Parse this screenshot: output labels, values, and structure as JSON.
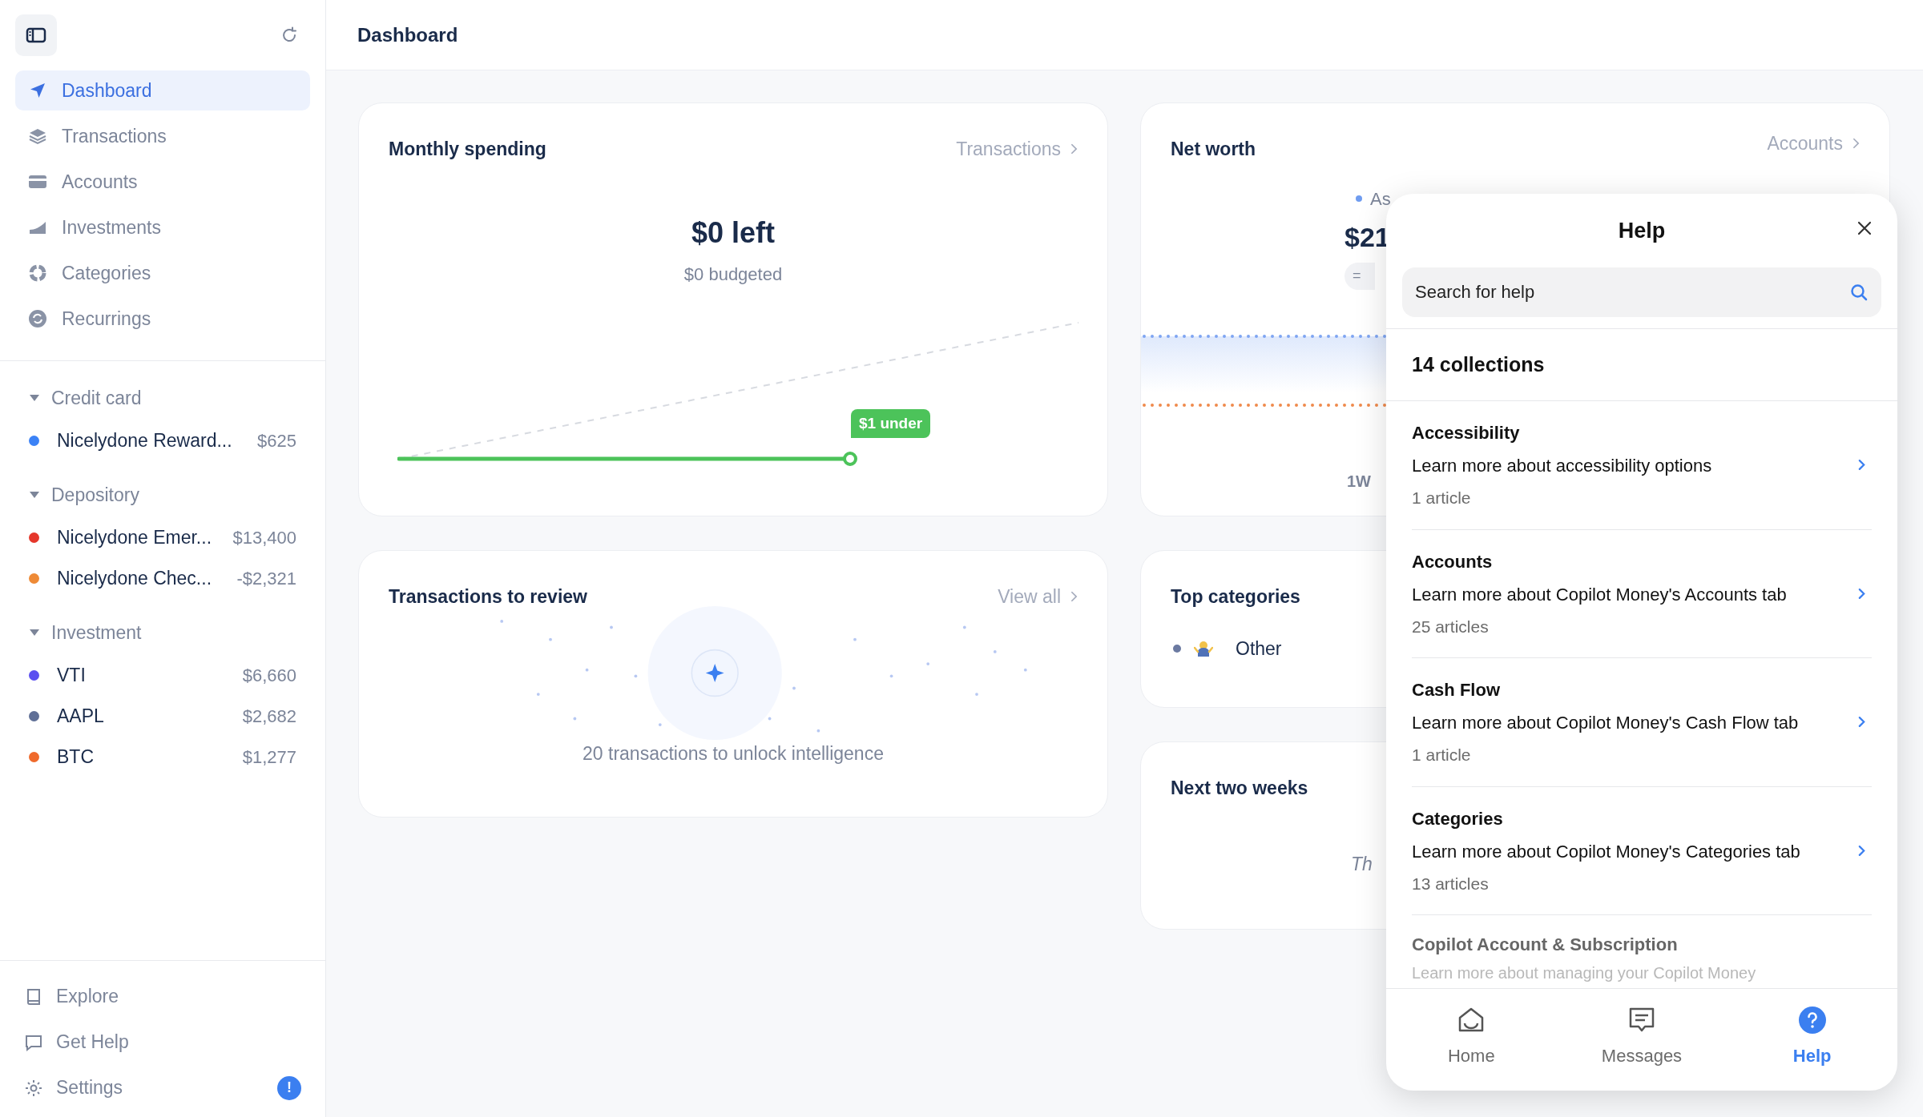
{
  "sidebar": {
    "nav": [
      {
        "label": "Dashboard",
        "selected": true
      },
      {
        "label": "Transactions",
        "selected": false
      },
      {
        "label": "Accounts",
        "selected": false
      },
      {
        "label": "Investments",
        "selected": false
      },
      {
        "label": "Categories",
        "selected": false
      },
      {
        "label": "Recurrings",
        "selected": false
      }
    ],
    "groups": [
      {
        "label": "Credit card",
        "expanded": true,
        "accounts": [
          {
            "name": "Nicelydone Reward...",
            "amount": "$625",
            "color": "#3b82f6"
          }
        ]
      },
      {
        "label": "Depository",
        "expanded": true,
        "accounts": [
          {
            "name": "Nicelydone Emer...",
            "amount": "$13,400",
            "color": "#e5372b"
          },
          {
            "name": "Nicelydone Chec...",
            "amount": "-$2,321",
            "color": "#ee8a36"
          }
        ]
      },
      {
        "label": "Investment",
        "expanded": true,
        "accounts": [
          {
            "name": "VTI",
            "amount": "$6,660",
            "color": "#5b4ff0"
          },
          {
            "name": "AAPL",
            "amount": "$2,682",
            "color": "#5f6f96"
          },
          {
            "name": "BTC",
            "amount": "$1,277",
            "color": "#ef6a2c"
          }
        ]
      }
    ],
    "footer": [
      {
        "label": "Explore"
      },
      {
        "label": "Get Help"
      },
      {
        "label": "Settings",
        "badge": "!"
      }
    ]
  },
  "header": {
    "title": "Dashboard"
  },
  "monthly_spending": {
    "title": "Monthly spending",
    "link": "Transactions",
    "amount": "$0 left",
    "budget": "$0 budgeted",
    "marker": "$1 under"
  },
  "net_worth": {
    "title": "Net worth",
    "link": "Accounts",
    "legend": "As",
    "value": "$21",
    "pill": "=",
    "period": "1W"
  },
  "transactions_review": {
    "title": "Transactions to review",
    "link": "View all",
    "message": "20 transactions to unlock intelligence"
  },
  "top_categories": {
    "title": "Top categories",
    "items": [
      {
        "label": "Other",
        "color": "#6b7aa1"
      }
    ]
  },
  "next_two_weeks": {
    "title": "Next two weeks",
    "note": "Th"
  },
  "help_panel": {
    "title": "Help",
    "placeholder": "Search for help",
    "count": "14 collections",
    "collections": [
      {
        "title": "Accessibility",
        "description": "Learn more about accessibility options",
        "articles": "1 article"
      },
      {
        "title": "Accounts",
        "description": "Learn more about Copilot Money's Accounts tab",
        "articles": "25 articles"
      },
      {
        "title": "Cash Flow",
        "description": "Learn more about Copilot Money's Cash Flow tab",
        "articles": "1 article"
      },
      {
        "title": "Categories",
        "description": "Learn more about Copilot Money's Categories tab",
        "articles": "13 articles"
      }
    ],
    "partial": {
      "title": "Copilot Account & Subscription",
      "description": "Learn more about managing your Copilot Money"
    },
    "tabs": [
      {
        "label": "Home",
        "selected": false
      },
      {
        "label": "Messages",
        "selected": false
      },
      {
        "label": "Help",
        "selected": true
      }
    ]
  }
}
